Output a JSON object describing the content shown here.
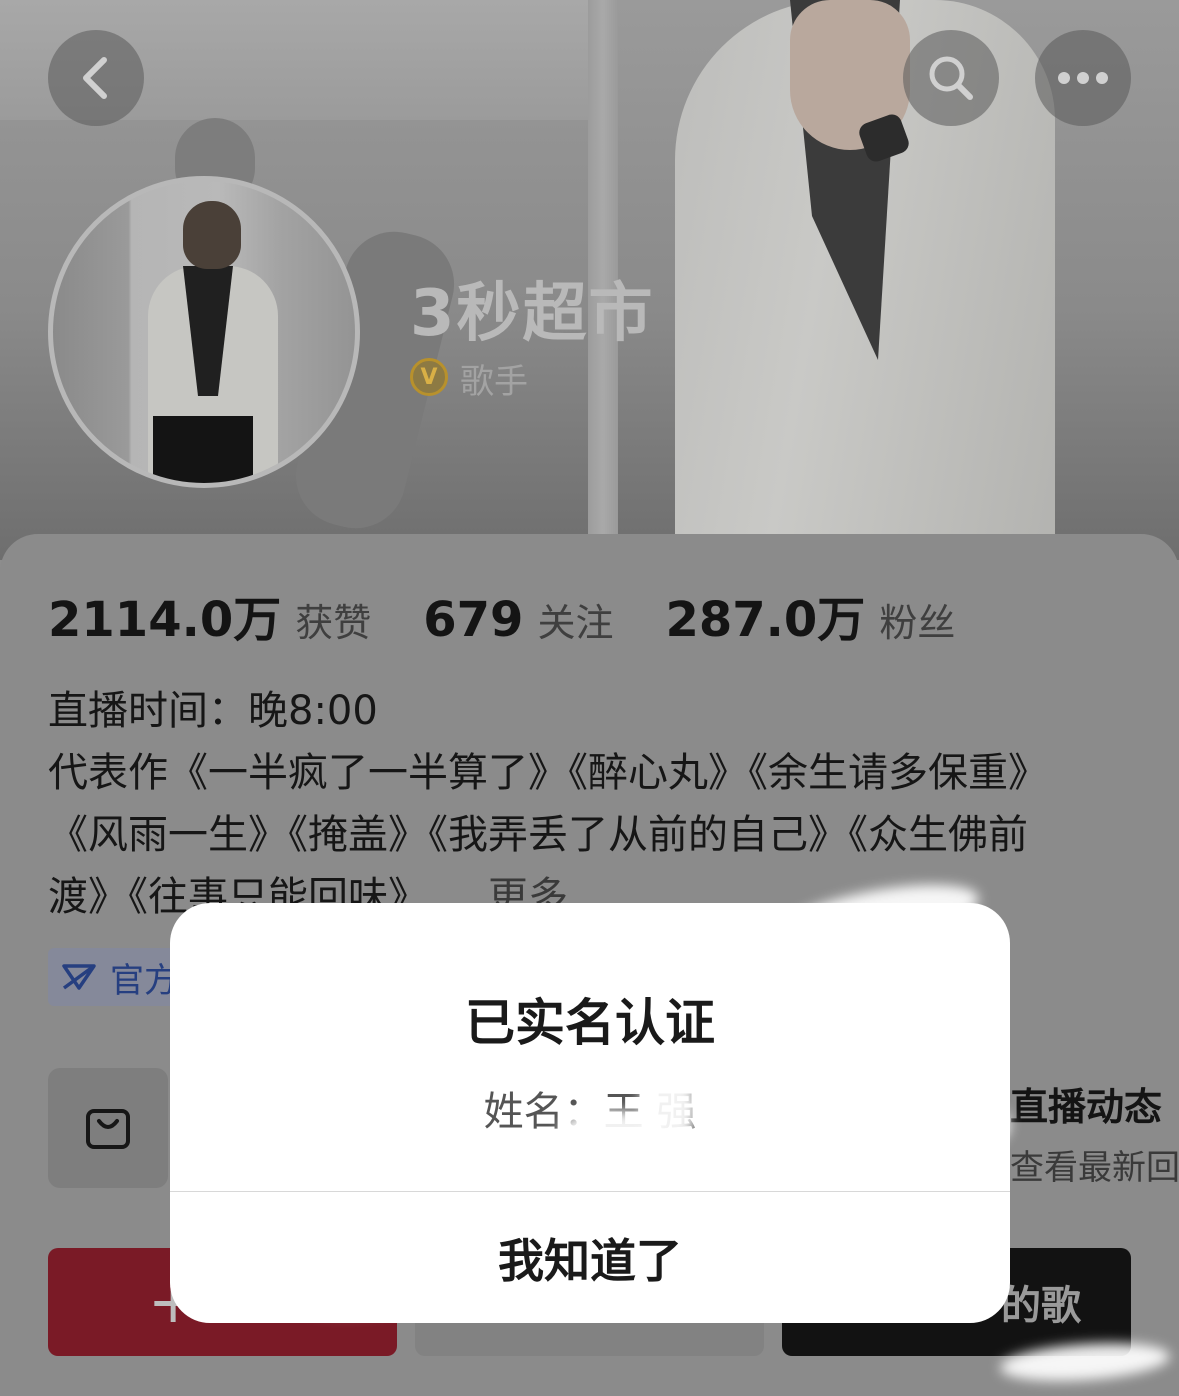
{
  "profile": {
    "name": "3秒超市",
    "tag": "歌手",
    "badge": "V"
  },
  "stats": [
    {
      "value": "2114.0万",
      "label": "获赞"
    },
    {
      "value": "679",
      "label": "关注"
    },
    {
      "value": "287.0万",
      "label": "粉丝"
    }
  ],
  "bio": {
    "line1": "直播时间：晚8:00",
    "line2": "代表作《一半疯了一半算了》《醉心丸》《余生请多保重》",
    "line3": "《风雨一生》《掩盖》《我弄丢了从前的自己》《众生佛前",
    "line4": "渡》《往事只能回味》",
    "more": "更多"
  },
  "official": {
    "label": "官方"
  },
  "live": {
    "title": "直播动态",
    "subtitle": "查看最新回"
  },
  "buttons": {
    "follow": "+",
    "songs": "的歌"
  },
  "modal": {
    "title": "已实名认证",
    "body": "姓名：王 强",
    "action": "我知道了"
  },
  "colors": {
    "follow_red": "#7a1a26",
    "verified_gold": "#b8912c",
    "official_blue": "#263f80"
  }
}
